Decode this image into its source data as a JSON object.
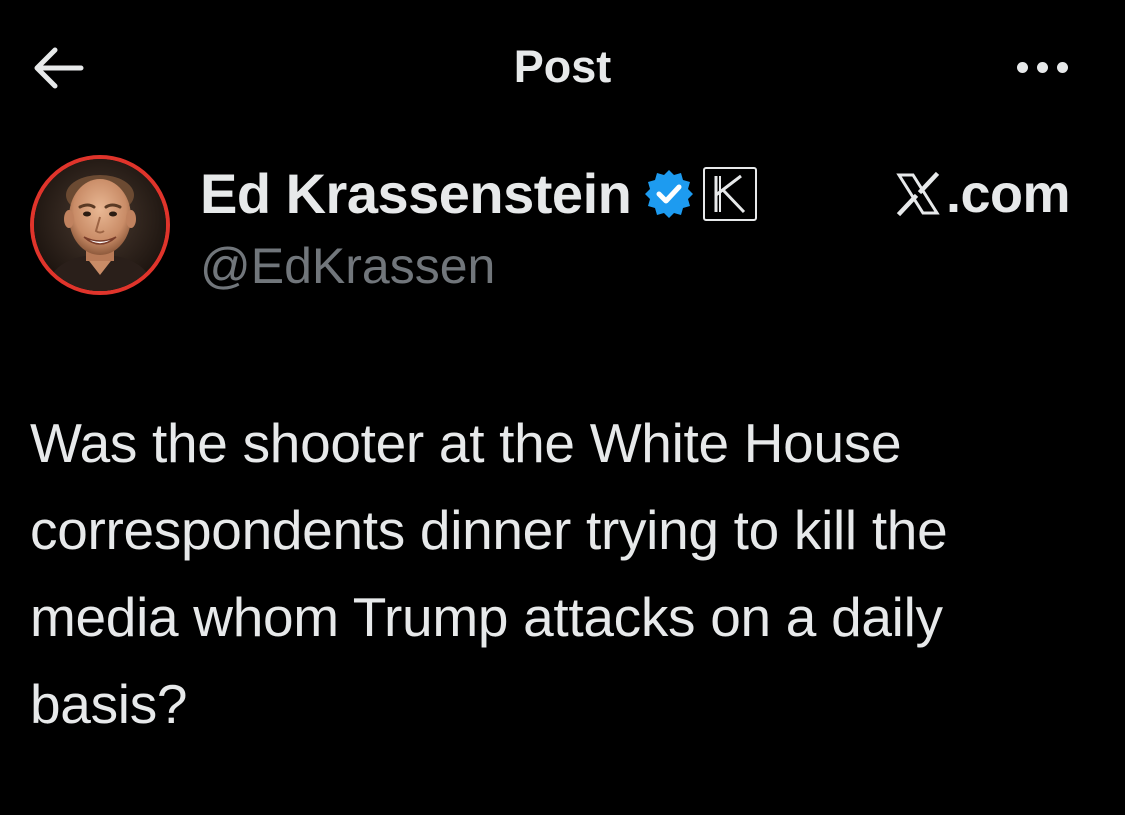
{
  "header": {
    "back_icon": "arrow-left-icon",
    "title": "Post",
    "more_icon": "more-horizontal-icon"
  },
  "author": {
    "display_name": "Ed Krassenstein",
    "handle": "@EdKrassen",
    "verified_icon": "verified-check-icon",
    "affiliate_icon": "k-affiliate-badge-icon",
    "avatar_ring_color": "#e0342b",
    "verified_color": "#1d9bf0"
  },
  "source": {
    "logo_icon": "x-logo-icon",
    "domain": ".com"
  },
  "post": {
    "text": "Was the shooter at the White House correspondents dinner trying to kill the media whom Trump attacks on a daily basis?"
  },
  "colors": {
    "background": "#000000",
    "primary_text": "#e7e9ea",
    "secondary_text": "#71767b"
  }
}
